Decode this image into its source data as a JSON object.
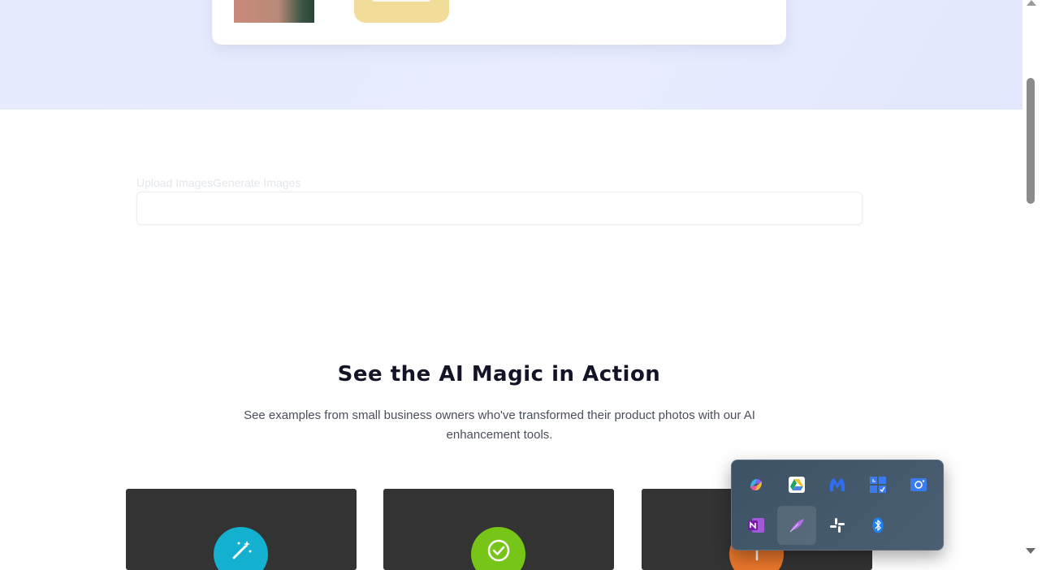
{
  "upload": {
    "tabs_label": "Upload ImagesGenerate Images"
  },
  "showcase": {
    "title": "See the AI Magic in Action",
    "subtitle": "See examples from small business owners who've transformed their product photos with our AI enhancement tools."
  },
  "feature_cards": [
    {
      "icon": "magic-wand-icon",
      "color": "#13b0cf"
    },
    {
      "icon": "check-circle-icon",
      "color": "#78c51a"
    },
    {
      "icon": "feature-icon",
      "color": "#e8762b"
    }
  ],
  "system_tray": {
    "icons": [
      "copilot-icon",
      "google-drive-icon",
      "malwarebytes-icon",
      "task-manager-icon",
      "camera-icon",
      "onenote-icon",
      "quill-icon",
      "slack-icon",
      "bluetooth-icon"
    ]
  }
}
